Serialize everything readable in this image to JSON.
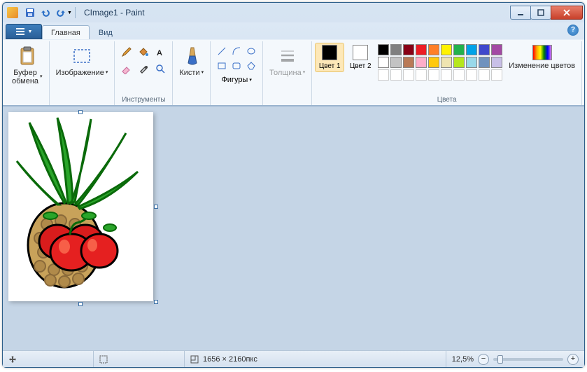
{
  "title": "CImage1 - Paint",
  "tabs": {
    "home": "Главная",
    "view": "Вид"
  },
  "groups": {
    "clipboard": {
      "label": "Буфер обмена",
      "paste": "Буфер обмена"
    },
    "image": {
      "label": "Изображение",
      "select": "Изображение"
    },
    "tools": {
      "label": "Инструменты"
    },
    "brushes": {
      "label": "Кисти"
    },
    "shapes": {
      "label": "Фигуры"
    },
    "size": {
      "label": "Толщина"
    },
    "colors": {
      "label": "Цвета",
      "color1": "Цвет 1",
      "color2": "Цвет 2",
      "edit": "Изменение цветов"
    }
  },
  "palette_row1": [
    "#000000",
    "#7f7f7f",
    "#880015",
    "#ed1c24",
    "#ff7f27",
    "#fff200",
    "#22b14c",
    "#00a2e8",
    "#3f48cc",
    "#a349a4"
  ],
  "palette_row2": [
    "#ffffff",
    "#c3c3c3",
    "#b97a57",
    "#ffaec9",
    "#ffc90e",
    "#efe4b0",
    "#b5e61d",
    "#99d9ea",
    "#7092be",
    "#c8bfe7"
  ],
  "color1_value": "#000000",
  "color2_value": "#ffffff",
  "status": {
    "dimensions": "1656 × 2160пкс",
    "zoom": "12,5%"
  }
}
